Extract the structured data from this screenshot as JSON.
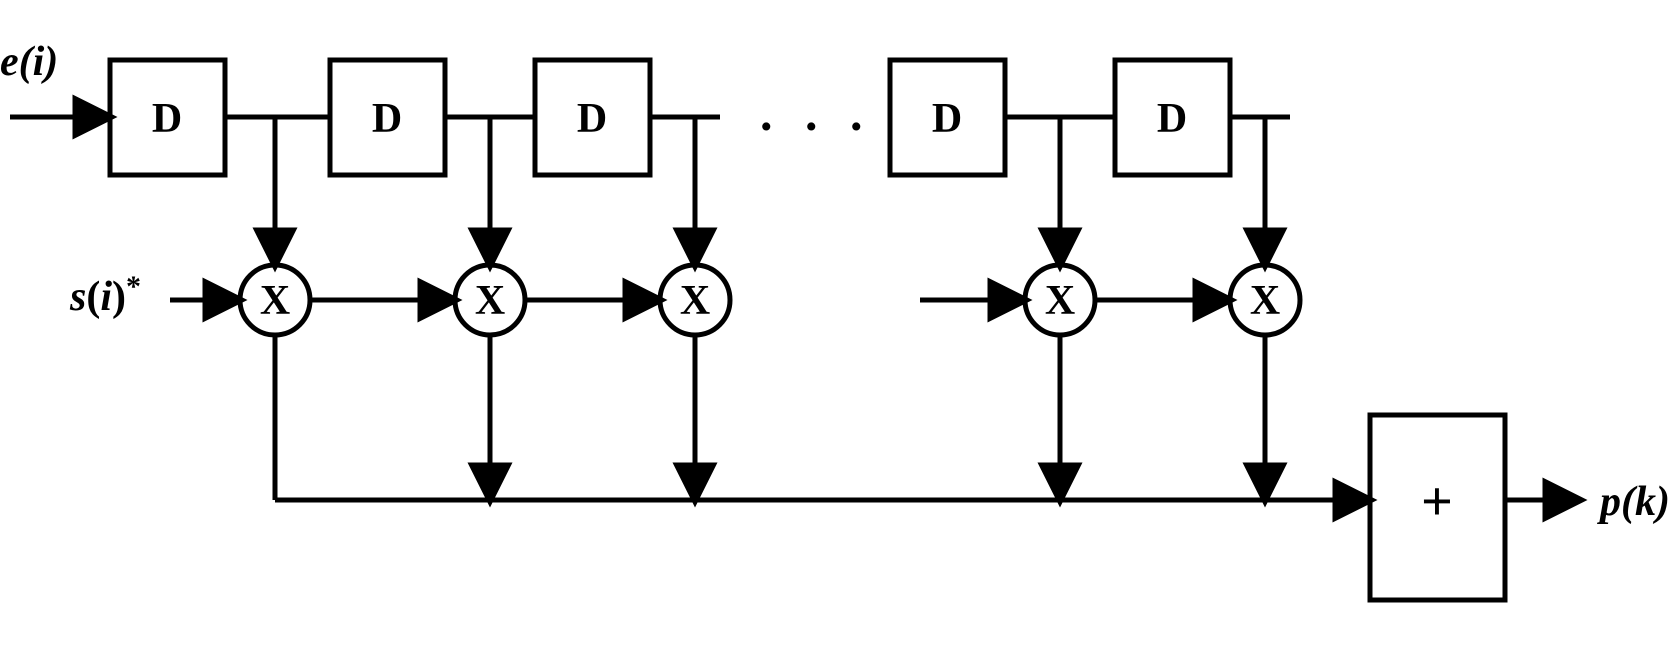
{
  "inputs": {
    "e": "e(i)",
    "s": "s(i)*"
  },
  "output": "p(k)",
  "delay_label": "D",
  "mult_label": "X",
  "sum_label": "+",
  "ellipsis": ". . .",
  "delay_blocks": 5,
  "multipliers": 5,
  "stroke": "#000000",
  "stroke_width": 5
}
